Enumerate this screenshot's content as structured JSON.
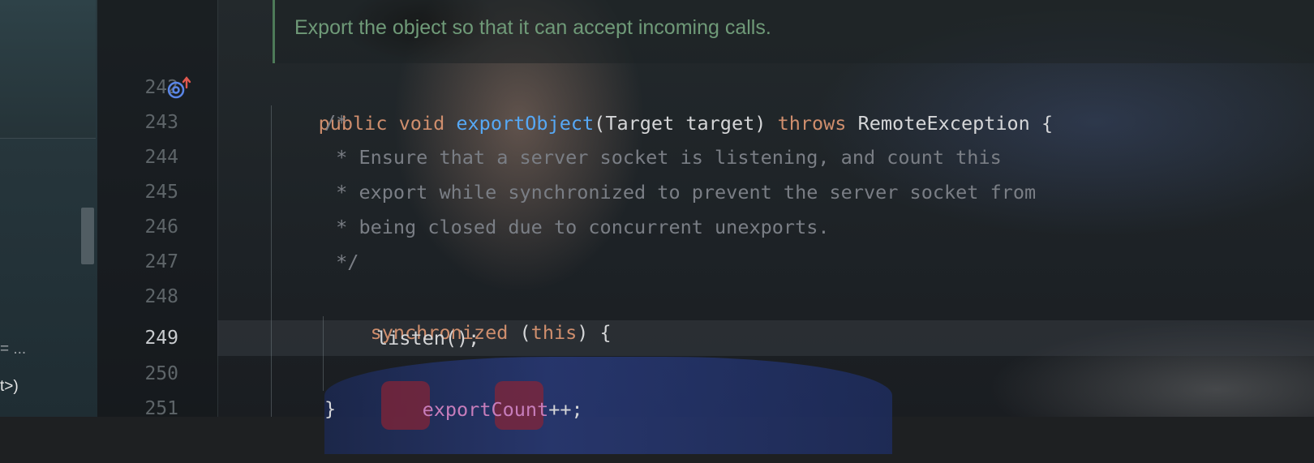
{
  "left_panel": {
    "line1": "= ...",
    "line2": "t>)"
  },
  "doc": {
    "text": "Export the object so that it can accept incoming calls."
  },
  "gutter": {
    "lines": [
      "242",
      "243",
      "244",
      "245",
      "246",
      "247",
      "248",
      "249",
      "250",
      "251"
    ],
    "current_line": "249",
    "override_icon": "implements-method-up-arrow-icon"
  },
  "code": {
    "l242": {
      "kw1": "public",
      "kw2": "void",
      "fn": "exportObject",
      "params": "(Target target)",
      "kw3": "throws",
      "rest": "RemoteException {"
    },
    "l243": "/*",
    "l244": " * Ensure that a server socket is listening, and count this",
    "l245": " * export while synchronized to prevent the server socket from",
    "l246": " * being closed due to concurrent unexports.",
    "l247": " */",
    "l248": {
      "kw": "synchronized",
      "open": " (",
      "kw_this": "this",
      "close": ") {"
    },
    "l249": "listen();",
    "l250": {
      "field": "exportCount",
      "rest": "++;"
    },
    "l251": "}"
  },
  "colors": {
    "keyword": "#cf8e6d",
    "function": "#56a8f5",
    "comment": "#7a7e85",
    "field": "#c77dbb",
    "doc_comment": "#6f9a78"
  }
}
